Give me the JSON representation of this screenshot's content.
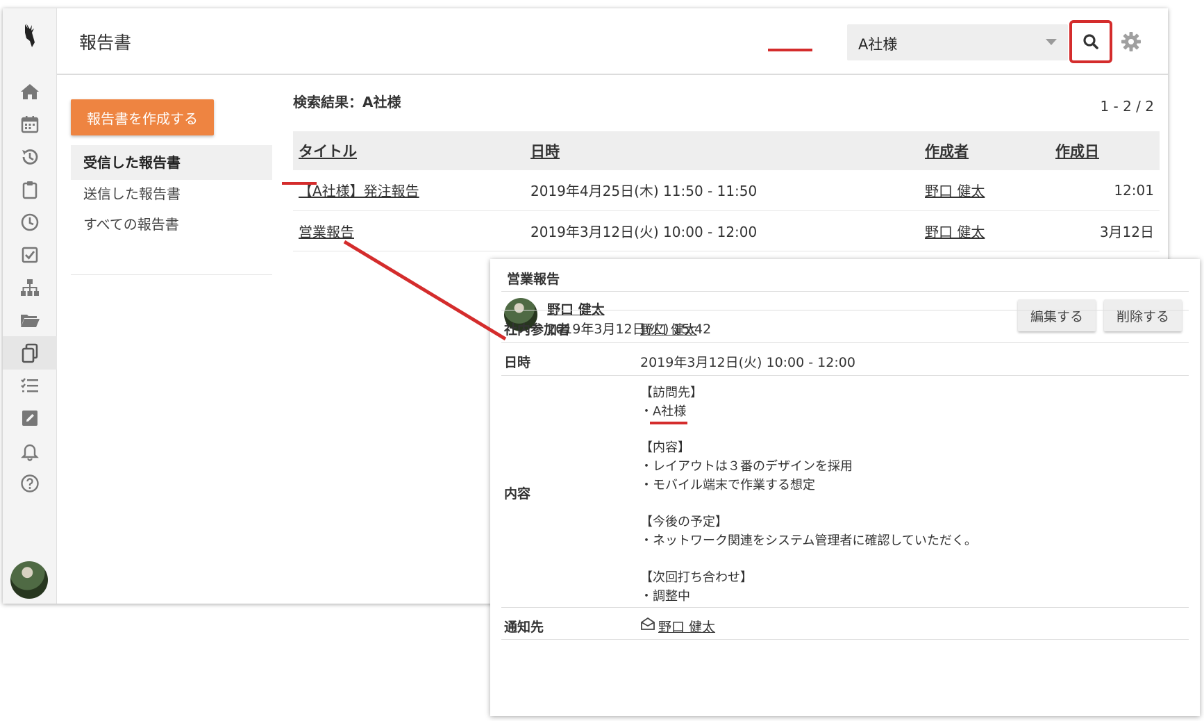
{
  "header": {
    "title": "報告書"
  },
  "search": {
    "value": "A社様"
  },
  "sidebar": {
    "create_label": "報告書を作成する",
    "links": [
      "受信した報告書",
      "送信した報告書",
      "すべての報告書"
    ]
  },
  "results": {
    "heading": "検索結果：A社様",
    "pager": "1 - 2 / 2",
    "columns": [
      "タイトル",
      "日時",
      "作成者",
      "作成日"
    ],
    "rows": [
      {
        "title": "【A社様】発注報告",
        "datetime": "2019年4月25日(木) 11:50 - 11:50",
        "author": "野口 健太",
        "created": "12:01"
      },
      {
        "title": "営業報告",
        "datetime": "2019年3月12日(火) 10:00 - 12:00",
        "author": "野口 健太",
        "created": "3月12日"
      }
    ]
  },
  "popup": {
    "title": "営業報告",
    "author": "野口 健太",
    "date": "2019年3月12日(火) 15:42",
    "edit_label": "編集する",
    "delete_label": "削除する",
    "participants_label": "社内参加者",
    "participants": "野口 健太",
    "datetime_label": "日時",
    "datetime": "2019年3月12日(火) 10:00 - 12:00",
    "content_label": "内容",
    "content_lines": [
      "【訪問先】",
      "・A社様",
      "",
      "【内容】",
      "・レイアウトは３番のデザインを採用",
      "・モバイル端末で作業する想定",
      "",
      "【今後の予定】",
      "・ネットワーク関連をシステム管理者に確認していただく。",
      "",
      "【次回打ち合わせ】",
      "・調整中"
    ],
    "notify_label": "通知先",
    "notify": "野口 健太"
  },
  "colors": {
    "accent": "#ee8441",
    "annotation": "#d42c2c"
  }
}
